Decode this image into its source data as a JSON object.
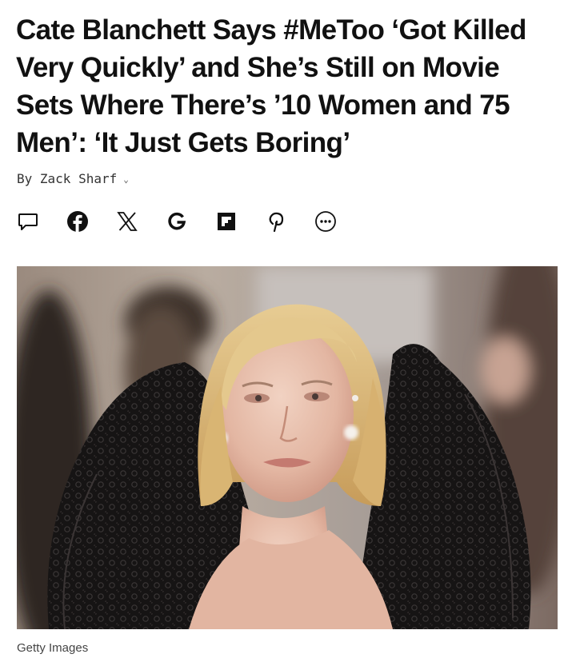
{
  "article": {
    "headline": "Cate Blanchett Says #MeToo ‘Got Killed Very Quickly’ and She’s Still on Movie Sets Where There’s ’10 Women and 75 Men’: ‘It Just Gets Boring’",
    "byline": "By Zack Sharf"
  },
  "share_bar": {
    "icons": [
      "comment-icon",
      "facebook-icon",
      "x-icon",
      "google-icon",
      "flipboard-icon",
      "pinterest-icon",
      "more-icon"
    ]
  },
  "photo": {
    "caption": "Getty Images"
  }
}
